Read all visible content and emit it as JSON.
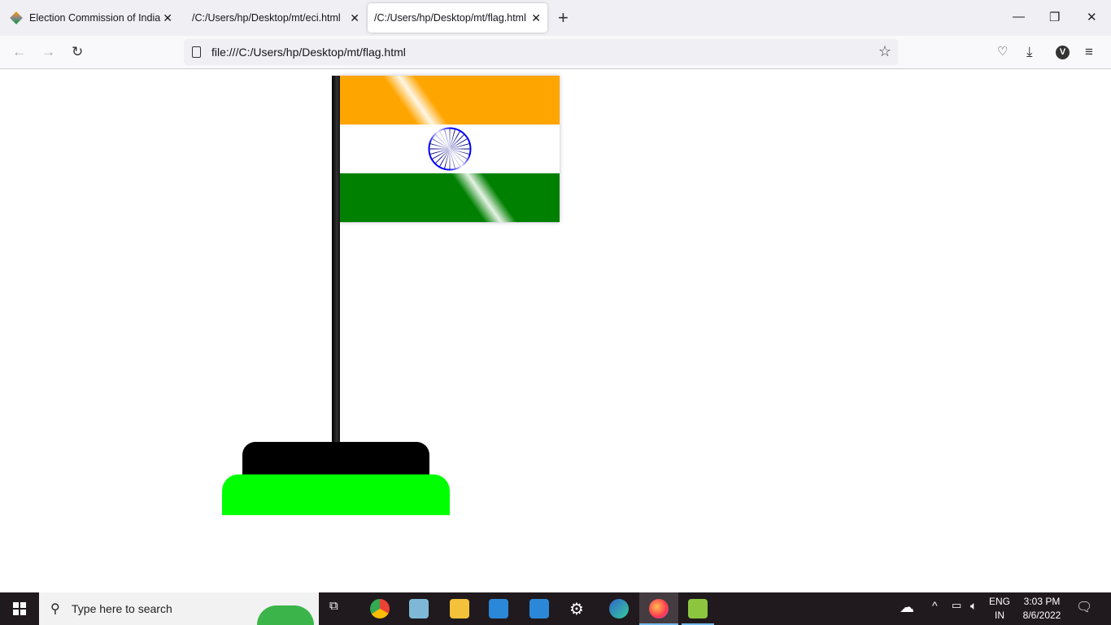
{
  "browser": {
    "tabs": [
      {
        "label": "Election Commission of India",
        "active": false
      },
      {
        "label": "/C:/Users/hp/Desktop/mt/eci.html",
        "active": false
      },
      {
        "label": "/C:/Users/hp/Desktop/mt/flag.html",
        "active": true
      }
    ],
    "close_glyph": "✕",
    "new_tab_glyph": "+",
    "url": "file:///C:/Users/hp/Desktop/mt/flag.html"
  },
  "flag": {
    "colors": {
      "saffron": "#ffa500",
      "white": "#ffffff",
      "green": "#008000",
      "chakra": "#0000ff",
      "base_top": "#000000",
      "base_bottom": "#00ff00"
    },
    "spokes": 24
  },
  "taskbar": {
    "search_placeholder": "Type here to search",
    "lang": "ENG",
    "region": "IN",
    "time": "3:03 PM",
    "date": "8/6/2022"
  }
}
